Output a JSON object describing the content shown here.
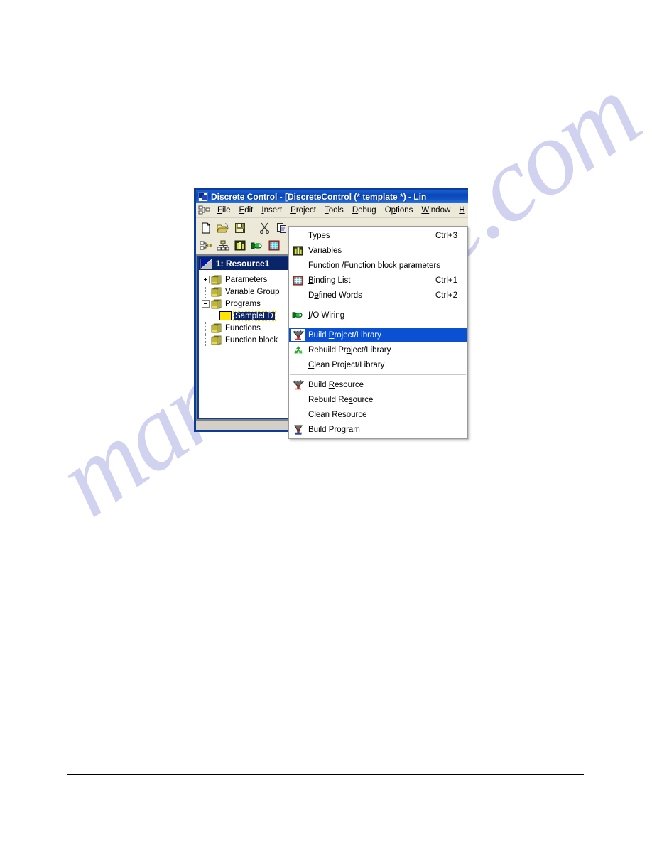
{
  "page": {
    "watermark_text": "manualslive.com"
  },
  "window": {
    "title": "Discrete Control - [DiscreteControl (* template *) - Lin",
    "app_icon": "app-icon",
    "mdi_system_icon": "mdi-system-icon",
    "menus": [
      {
        "name": "file",
        "pre": "",
        "key": "F",
        "post": "ile"
      },
      {
        "name": "edit",
        "pre": "",
        "key": "E",
        "post": "dit"
      },
      {
        "name": "insert",
        "pre": "",
        "key": "I",
        "post": "nsert"
      },
      {
        "name": "project",
        "pre": "",
        "key": "P",
        "post": "roject"
      },
      {
        "name": "tools",
        "pre": "",
        "key": "T",
        "post": "ools"
      },
      {
        "name": "debug",
        "pre": "",
        "key": "D",
        "post": "ebug"
      },
      {
        "name": "options",
        "pre": "O",
        "key": "p",
        "post": "tions"
      },
      {
        "name": "window",
        "pre": "",
        "key": "W",
        "post": "indow"
      },
      {
        "name": "help",
        "pre": "",
        "key": "H",
        "post": ""
      }
    ],
    "toolbar_row1": [
      {
        "name": "new-file-icon"
      },
      {
        "name": "open-folder-icon"
      },
      {
        "name": "save-disk-icon"
      },
      {
        "name": "separator"
      },
      {
        "name": "cut-scissors-icon"
      },
      {
        "name": "copy-icon"
      }
    ],
    "toolbar_row2": [
      {
        "name": "hierarchy-icon"
      },
      {
        "name": "network-icon"
      },
      {
        "name": "variables-icon"
      },
      {
        "name": "io-wiring-icon"
      },
      {
        "name": "binding-list-icon"
      }
    ]
  },
  "mdi_child": {
    "title": "1: Resource1",
    "tree": [
      {
        "name": "parameters",
        "label": "Parameters",
        "icon": "folder-icon",
        "expander": "plus",
        "depth": 0
      },
      {
        "name": "variable-group",
        "label": "Variable Group",
        "icon": "folder-icon",
        "expander": "none",
        "depth": 0
      },
      {
        "name": "programs",
        "label": "Programs",
        "icon": "folder-icon",
        "expander": "minus",
        "depth": 0
      },
      {
        "name": "sampleld",
        "label": "SampleLD",
        "icon": "program-icon",
        "expander": "none",
        "depth": 1,
        "selected": true
      },
      {
        "name": "functions",
        "label": "Functions",
        "icon": "folder-icon",
        "expander": "none",
        "depth": 0
      },
      {
        "name": "function-block",
        "label": "Function block",
        "icon": "folder-icon",
        "expander": "none",
        "depth": 0
      }
    ]
  },
  "project_menu": {
    "items": [
      {
        "type": "item",
        "name": "types",
        "pre": "T",
        "key": "y",
        "post": "pes",
        "label": "Types",
        "accel": "Ctrl+3",
        "icon": "none"
      },
      {
        "type": "item",
        "name": "variables",
        "pre": "",
        "key": "V",
        "post": "ariables",
        "label": "Variables",
        "accel": "",
        "icon": "variables-icon"
      },
      {
        "type": "item",
        "name": "function-function-block-parameters",
        "pre": "",
        "key": "F",
        "post": "unction /Function block parameters",
        "label": "Function /Function block parameters",
        "accel": "",
        "icon": "none"
      },
      {
        "type": "item",
        "name": "binding-list",
        "pre": "",
        "key": "B",
        "post": "inding List",
        "label": "Binding List",
        "accel": "Ctrl+1",
        "icon": "binding-list-icon"
      },
      {
        "type": "item",
        "name": "defined-words",
        "pre": "D",
        "key": "e",
        "post": "fined Words",
        "label": "Defined Words",
        "accel": "Ctrl+2",
        "icon": "none"
      },
      {
        "type": "separator",
        "name": "separator-1"
      },
      {
        "type": "item",
        "name": "io-wiring",
        "pre": "",
        "key": "I",
        "post": "/O Wiring",
        "label": "I/O Wiring",
        "accel": "",
        "icon": "io-wiring-icon"
      },
      {
        "type": "separator",
        "name": "separator-2"
      },
      {
        "type": "item",
        "name": "build-project-library",
        "pre": "Build ",
        "key": "P",
        "post": "roject/Library",
        "label": "Build Project/Library",
        "accel": "",
        "icon": "build-icon",
        "selected": true
      },
      {
        "type": "item",
        "name": "rebuild-project-library",
        "pre": "Rebuild Pr",
        "key": "o",
        "post": "ject/Library",
        "label": "Rebuild Project/Library",
        "accel": "",
        "icon": "rebuild-recycle-icon"
      },
      {
        "type": "item",
        "name": "clean-project-library",
        "pre": "",
        "key": "C",
        "post": "lean Project/Library",
        "label": "Clean Project/Library",
        "accel": "",
        "icon": "none"
      },
      {
        "type": "separator",
        "name": "separator-3"
      },
      {
        "type": "item",
        "name": "build-resource",
        "pre": "Build ",
        "key": "R",
        "post": "esource",
        "label": "Build Resource",
        "accel": "",
        "icon": "build-resource-icon"
      },
      {
        "type": "item",
        "name": "rebuild-resource",
        "pre": "Rebuild Re",
        "key": "s",
        "post": "ource",
        "label": "Rebuild Resource",
        "accel": "",
        "icon": "none"
      },
      {
        "type": "item",
        "name": "clean-resource",
        "pre": "C",
        "key": "l",
        "post": "ean Resource",
        "label": "Clean Resource",
        "accel": "",
        "icon": "none"
      },
      {
        "type": "item",
        "name": "build-program",
        "pre": "Build Pro",
        "key": "g",
        "post": "ram",
        "label": "Build Program",
        "accel": "",
        "icon": "build-program-icon"
      }
    ]
  },
  "colors": {
    "titlebar_blue": "#0b47b5",
    "menu_highlight": "#0a50d2",
    "tree_selection": "#0a246a",
    "window_border": "#0b3c97",
    "chrome_face": "#ece9d8",
    "watermark": "#c9cbed"
  }
}
